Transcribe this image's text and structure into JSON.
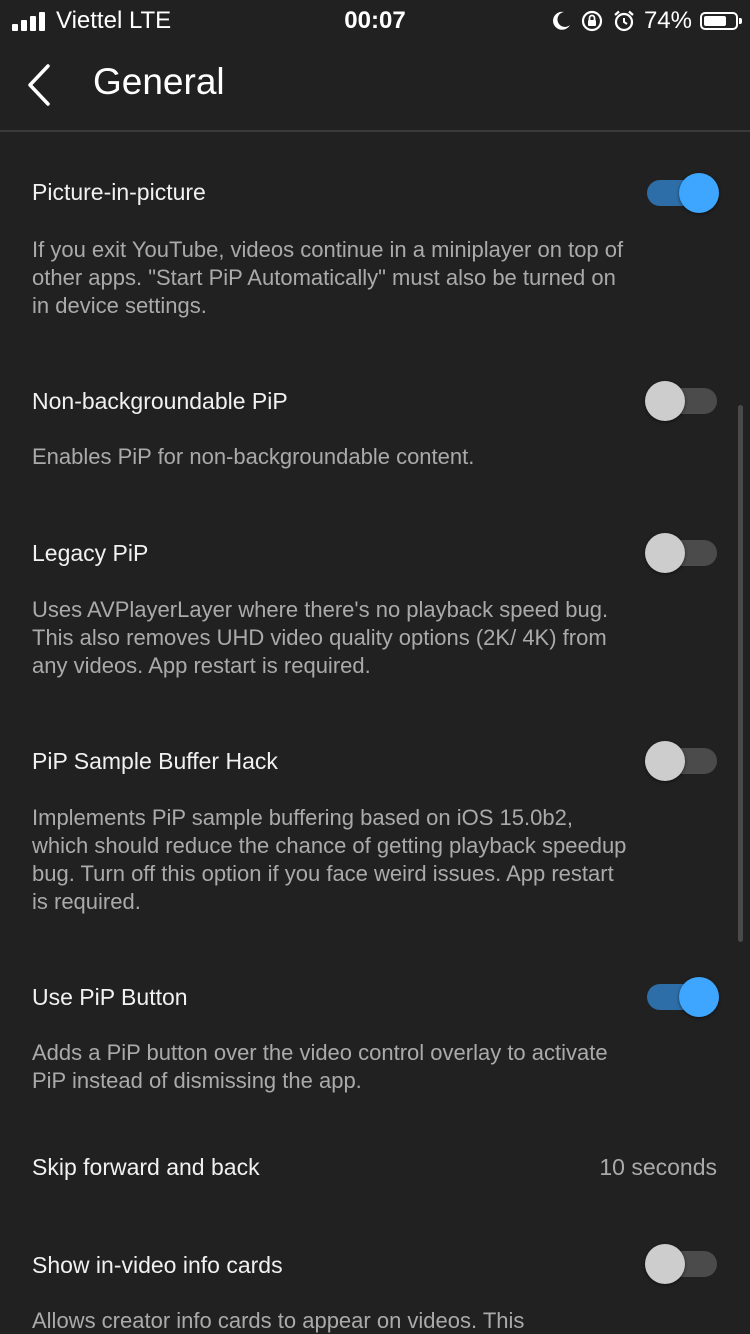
{
  "status_bar": {
    "carrier": "Viettel  LTE",
    "time": "00:07",
    "battery_percent": "74%",
    "battery_level": 0.74,
    "icons": [
      "signal-icon",
      "moon-icon",
      "rotation-lock-icon",
      "alarm-icon",
      "battery-icon"
    ]
  },
  "header": {
    "title": "General",
    "back_icon": "chevron-left-icon"
  },
  "settings": [
    {
      "title": "Picture-in-picture",
      "description": "If you exit YouTube, videos continue in a miniplayer on top of other apps. \"Start PiP Automatically\" must also be turned on in device settings.",
      "enabled": true
    },
    {
      "title": "Non-backgroundable PiP",
      "description": "Enables PiP for non-backgroundable content.",
      "enabled": false
    },
    {
      "title": "Legacy PiP",
      "description": "Uses AVPlayerLayer where there's no playback speed bug. This also removes UHD video quality options (2K/ 4K) from any videos. App restart is required.",
      "enabled": false
    },
    {
      "title": "PiP Sample Buffer Hack",
      "description": "Implements PiP sample buffering based on iOS 15.0b2, which should reduce the chance of getting playback speedup bug. Turn off this option if you face weird issues. App restart is required.",
      "enabled": false
    },
    {
      "title": "Use PiP Button",
      "description": "Adds a PiP button over the video control overlay to activate PiP instead of dismissing the app.",
      "enabled": true
    },
    {
      "title": "Skip forward and back",
      "value": "10 seconds"
    },
    {
      "title": "Show in-video info cards",
      "description": "Allows creator info cards to appear on videos. This",
      "enabled": false
    }
  ],
  "colors": {
    "background": "#212121",
    "toggle_on_knob": "#3ea6ff",
    "toggle_on_track": "#2d6ea8",
    "toggle_off_knob": "#cdcdcd",
    "toggle_off_track": "#4b4b4b",
    "secondary_text": "#aaaaaa"
  }
}
